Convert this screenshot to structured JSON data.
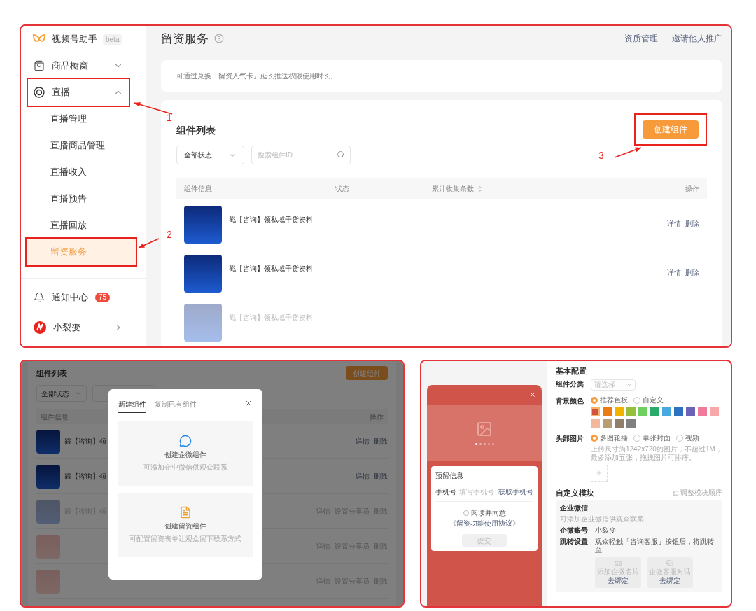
{
  "top": {
    "sidebar": {
      "brand": "视频号助手",
      "badge": "beta",
      "groups": [
        {
          "label": "商品橱窗",
          "expanded": false,
          "highlighted": false
        },
        {
          "label": "直播",
          "expanded": true,
          "highlighted": true,
          "children": [
            {
              "label": "直播管理",
              "selected": false,
              "highlighted": false
            },
            {
              "label": "直播商品管理",
              "selected": false,
              "highlighted": false
            },
            {
              "label": "直播收入",
              "selected": false,
              "highlighted": false
            },
            {
              "label": "直播预告",
              "selected": false,
              "highlighted": false
            },
            {
              "label": "直播回放",
              "selected": false,
              "highlighted": false
            },
            {
              "label": "留资服务",
              "selected": true,
              "highlighted": true
            }
          ]
        }
      ],
      "footer": [
        {
          "label": "通知中心",
          "count": "75",
          "kind": "notice"
        },
        {
          "label": "小裂变",
          "kind": "link"
        }
      ]
    },
    "header": {
      "title": "留资服务",
      "links": [
        "资质管理",
        "邀请他人推广"
      ]
    },
    "notice": "可通过兑换「留资人气卡」延长推送权限使用时长。",
    "list": {
      "title": "组件列表",
      "create_button": {
        "label": "创建组件",
        "highlighted": true
      },
      "status_filter": "全部状态",
      "search_placeholder": "搜索组件ID",
      "columns": [
        {
          "label": "组件信息"
        },
        {
          "label": "状态"
        },
        {
          "label": "累计收集条数",
          "sortable": true
        },
        {
          "label": "操作"
        }
      ],
      "rows": [
        {
          "title": "戳【咨询】领私域干货资料",
          "dimmed": false,
          "actions": [
            "详情",
            "删除"
          ]
        },
        {
          "title": "戳【咨询】领私域干货资料",
          "dimmed": false,
          "actions": [
            "详情",
            "删除"
          ]
        },
        {
          "title": "戳【咨询】领私域干货资料",
          "dimmed": true
        }
      ]
    },
    "annotations": [
      {
        "label": "1"
      },
      {
        "label": "2"
      },
      {
        "label": "3"
      }
    ]
  },
  "modal_demo": {
    "background": {
      "title": "组件列表",
      "create_button": "创建组件",
      "status_filter": "全部状态",
      "columns": [
        "组件信息",
        "操作"
      ],
      "rows": [
        {
          "title": "戳【咨询】领",
          "kind": "blue",
          "dimmed": false,
          "actions": [
            "详情",
            "删除"
          ]
        },
        {
          "title": "戳【咨询】领",
          "kind": "blue",
          "dimmed": false,
          "actions": [
            "详情",
            "删除"
          ]
        },
        {
          "title": "戳【咨询】领",
          "kind": "blue",
          "dimmed": true,
          "actions": [
            "详情",
            "设置分享员",
            "删除"
          ]
        },
        {
          "kind": "red",
          "dimmed": true,
          "actions": [
            "详情",
            "设置分享员",
            "删除"
          ]
        },
        {
          "kind": "red",
          "dimmed": true,
          "actions": [
            "详情",
            "设置分享员",
            "删除"
          ]
        }
      ]
    },
    "dialog": {
      "tabs": [
        {
          "label": "新建组件",
          "selected": true
        },
        {
          "label": "复制已有组件",
          "selected": false
        }
      ],
      "options": [
        {
          "title": "创建企微组件",
          "description": "可添加企业微信供观众联系"
        },
        {
          "title": "创建留资组件",
          "description": "可配置留资表单让观众留下联系方式"
        }
      ]
    }
  },
  "editor": {
    "preview": {
      "carousel": [
        {
          "selected": true
        },
        {
          "selected": false
        },
        {
          "selected": false
        },
        {
          "selected": false
        },
        {
          "selected": false
        }
      ],
      "form_title": "预留信息",
      "phone_label": "手机号",
      "phone_placeholder": "填写手机号",
      "get_phone": "获取手机号",
      "agree_checked": false,
      "agreement": "阅读并同意",
      "agreement_link": "《留资功能使用协议》",
      "submit": "提交"
    },
    "basic": {
      "title": "基本配置",
      "fields": [
        {
          "label": "组件分类",
          "kind": "select",
          "placeholder": "请选择"
        },
        {
          "label": "背景颜色",
          "kind": "color",
          "options": [
            {
              "label": "推荐色板",
              "selected": true
            },
            {
              "label": "自定义",
              "selected": false
            }
          ],
          "swatches": [
            {
              "color": "#d4503f",
              "selected": true
            },
            {
              "color": "#ec7a12",
              "selected": false
            },
            {
              "color": "#f0b400",
              "selected": false
            },
            {
              "color": "#98bf3c",
              "selected": false
            },
            {
              "color": "#6fcf5f",
              "selected": false
            },
            {
              "color": "#2bab6a",
              "selected": false
            },
            {
              "color": "#48a8e0",
              "selected": false
            },
            {
              "color": "#2d72c0",
              "selected": false
            },
            {
              "color": "#6b63b8",
              "selected": false
            },
            {
              "color": "#f07a9a",
              "selected": false
            },
            {
              "color": "#f8a8a8",
              "selected": false
            },
            {
              "color": "#f3b79b",
              "selected": false
            },
            {
              "color": "#b89c74",
              "selected": false
            },
            {
              "color": "#8f7e6a",
              "selected": false
            },
            {
              "color": "#808080",
              "selected": false
            }
          ]
        },
        {
          "label": "头部图片",
          "kind": "upload",
          "options": [
            {
              "label": "多图轮播",
              "selected": true
            },
            {
              "label": "单张封面",
              "selected": false
            },
            {
              "label": "视频",
              "selected": false
            }
          ],
          "hint": "上传尺寸为1242x720的图片，不超过1M，最多添加五张，拖拽图片可排序。"
        }
      ]
    },
    "custom": {
      "title": "自定义模块",
      "sort_link": "调整模块顺序",
      "module": {
        "title": "企业微信",
        "description": "可添加企业微信供观众联系",
        "rows": [
          {
            "label": "企微账号",
            "value": "小裂变"
          },
          {
            "label": "跳转设置",
            "value": "观众轻触「咨询客服」按钮后，将跳转至"
          }
        ],
        "cards": [
          {
            "label": "添加企微名片",
            "action": "去绑定"
          },
          {
            "label": "企微客服对话",
            "action": "去绑定"
          }
        ]
      }
    }
  }
}
